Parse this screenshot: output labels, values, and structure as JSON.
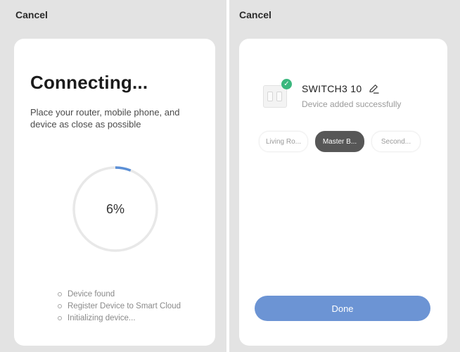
{
  "left_screen": {
    "cancel_label": "Cancel",
    "title": "Connecting...",
    "subtitle": "Place your router, mobile phone, and device as close as possible",
    "progress": {
      "percent": 6,
      "label": "6%"
    },
    "steps": [
      {
        "label": "Device found"
      },
      {
        "label": "Register Device to Smart Cloud"
      },
      {
        "label": "Initializing device..."
      }
    ]
  },
  "right_screen": {
    "cancel_label": "Cancel",
    "device": {
      "name": "SWITCH3 10",
      "status": "Device added successfully",
      "icon": "wall-switch-icon",
      "badge_icon": "check-circle-icon",
      "edit_icon": "pencil-icon"
    },
    "rooms": [
      {
        "label": "Living Ro...",
        "selected": false
      },
      {
        "label": "Master B...",
        "selected": true
      },
      {
        "label": "Second...",
        "selected": false
      }
    ],
    "done_label": "Done"
  },
  "colors": {
    "background": "#e3e3e3",
    "card": "#ffffff",
    "progress_arc": "#5b8fd6",
    "progress_track": "#e8e8e8",
    "success_badge": "#3bb77e",
    "selected_chip": "#575757",
    "primary_button": "#6c94d4"
  }
}
